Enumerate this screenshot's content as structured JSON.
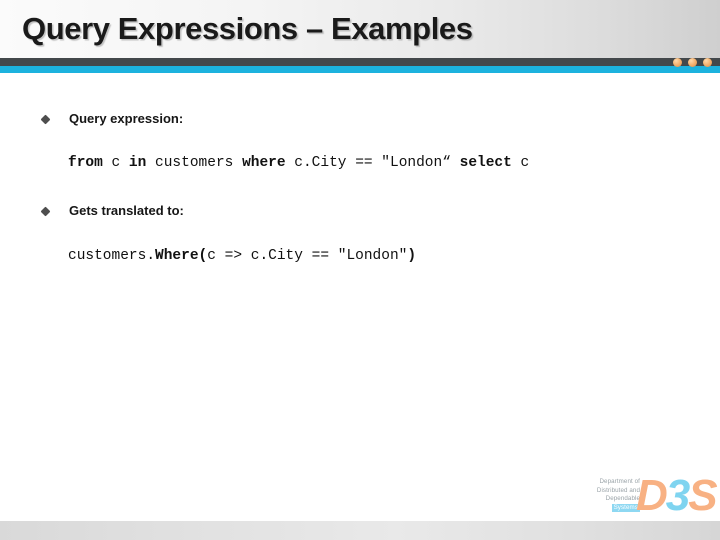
{
  "slide": {
    "title": "Query Expressions – Examples",
    "accent_color": "#1cb2de",
    "bar_dark_color": "#43484b",
    "dot_color": "#f3ac68"
  },
  "bullets": [
    {
      "label": "Query expression:"
    },
    {
      "label": "Gets translated to:"
    }
  ],
  "code_blocks": [
    {
      "id": "query-expression",
      "full_text": "from c in customers where c.City == \"London“ select c",
      "tokens": [
        {
          "text": "from",
          "bold": true
        },
        {
          "text": " ",
          "bold": false
        },
        {
          "text": "c",
          "bold": false
        },
        {
          "text": " ",
          "bold": false
        },
        {
          "text": "in",
          "bold": true
        },
        {
          "text": " ",
          "bold": false
        },
        {
          "text": "customers",
          "bold": false
        },
        {
          "text": " ",
          "bold": false
        },
        {
          "text": "where",
          "bold": true
        },
        {
          "text": " ",
          "bold": false
        },
        {
          "text": "c.City == \"London“",
          "bold": false
        },
        {
          "text": " ",
          "bold": false
        },
        {
          "text": "select",
          "bold": true
        },
        {
          "text": " ",
          "bold": false
        },
        {
          "text": "c",
          "bold": false
        }
      ]
    },
    {
      "id": "translated-expression",
      "full_text": "customers.Where(c => c.City == \"London\")",
      "tokens": [
        {
          "text": "customers.",
          "bold": false
        },
        {
          "text": "Where(",
          "bold": true
        },
        {
          "text": "c => c.City == \"London\"",
          "bold": false
        },
        {
          "text": ")",
          "bold": true
        }
      ]
    }
  ],
  "logo": {
    "line1": "Department of",
    "line2": "Distributed and",
    "line3": "Dependable",
    "line4": "Systems",
    "mark_left": "D",
    "mark_mid": "3",
    "mark_right": "S"
  }
}
